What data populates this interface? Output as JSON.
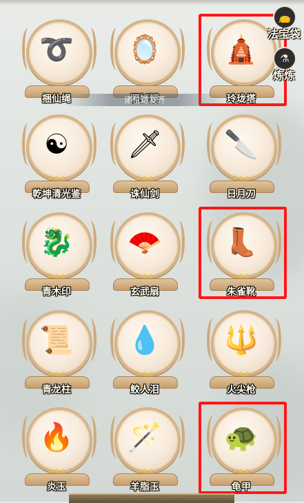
{
  "banner": {
    "text": "诸位道友齐"
  },
  "side_buttons": [
    {
      "label": "法宝袋",
      "icon": "pouch-icon"
    },
    {
      "label": "炼炼",
      "icon": "furnace-icon"
    }
  ],
  "items": [
    {
      "id": "kunxiansheng",
      "label": "捆仙绳",
      "icon": "rope-icon",
      "glyph": "➰",
      "stars": "",
      "highlighted": false
    },
    {
      "id": "zhaoyaojing",
      "label": "照妖镜",
      "icon": "mirror-icon",
      "glyph": "🪞",
      "stars": "",
      "highlighted": false
    },
    {
      "id": "linglongta",
      "label": "玲珑塔",
      "icon": "pagoda-icon",
      "glyph": "🛕",
      "stars": "",
      "highlighted": true
    },
    {
      "id": "qiankunjian",
      "label": "乾坤清光鉴",
      "icon": "yinyang-mirror-icon",
      "glyph": "☯",
      "stars": "★★★",
      "highlighted": false
    },
    {
      "id": "zhuxianjian",
      "label": "诛仙剑",
      "icon": "sword-icon",
      "glyph": "🗡",
      "stars": "★★★",
      "highlighted": false
    },
    {
      "id": "riyuedao",
      "label": "日月刀",
      "icon": "blade-icon",
      "glyph": "🔪",
      "stars": "★★★",
      "highlighted": false
    },
    {
      "id": "qingmuyin",
      "label": "青木印",
      "icon": "seal-icon",
      "glyph": "🐉",
      "stars": "★★★",
      "highlighted": false
    },
    {
      "id": "xuanwushan",
      "label": "玄武扇",
      "icon": "fan-icon",
      "glyph": "🪭",
      "stars": "★★★",
      "highlighted": false
    },
    {
      "id": "zhuquexue",
      "label": "朱雀靴",
      "icon": "boots-icon",
      "glyph": "👢",
      "stars": "★★★",
      "highlighted": true
    },
    {
      "id": "qinglongzhu",
      "label": "青龙柱",
      "icon": "pillar-icon",
      "glyph": "📜",
      "stars": "★★★",
      "highlighted": false
    },
    {
      "id": "jiaorenlei",
      "label": "鲛人泪",
      "icon": "tear-pendant-icon",
      "glyph": "💧",
      "stars": "★★★",
      "highlighted": false
    },
    {
      "id": "huojianqiang",
      "label": "火尖枪",
      "icon": "spear-icon",
      "glyph": "🔱",
      "stars": "★★★",
      "highlighted": false
    },
    {
      "id": "yanyu",
      "label": "炎玉",
      "icon": "flame-jade-icon",
      "glyph": "🔥",
      "stars": "★★★",
      "highlighted": false
    },
    {
      "id": "yangzhiyu",
      "label": "羊脂玉",
      "icon": "ruyi-jade-icon",
      "glyph": "🪄",
      "stars": "★★★",
      "highlighted": false
    },
    {
      "id": "guijia",
      "label": "龟甲",
      "icon": "tortoise-shell-icon",
      "glyph": "🐢",
      "stars": "★★★",
      "highlighted": true
    }
  ],
  "colors": {
    "highlight": "#ff1616",
    "stand": "#d4b48a",
    "star": "#f5c842"
  }
}
